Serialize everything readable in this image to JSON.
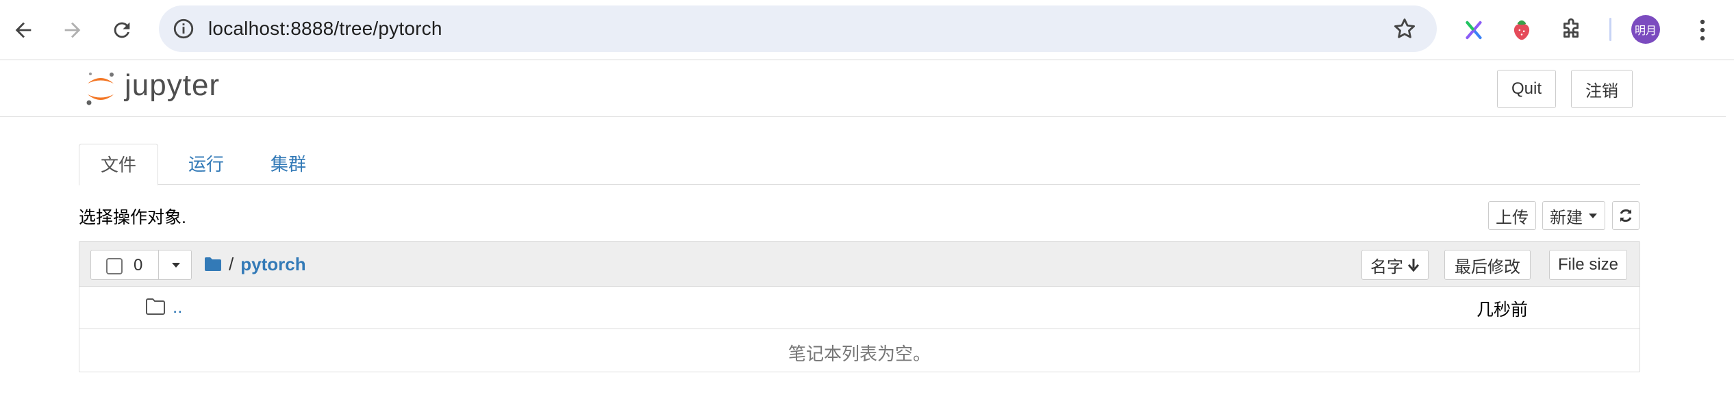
{
  "browser": {
    "url": "localhost:8888/tree/pytorch",
    "profile_initials": "明月",
    "icons": [
      "back-icon",
      "forward-icon",
      "reload-icon",
      "site-info-icon",
      "bookmark-star-icon",
      "x-extension-icon",
      "strawberry-extension-icon",
      "extensions-puzzle-icon",
      "more-menu-icon"
    ]
  },
  "header": {
    "logo_text": "jupyter",
    "quit_label": "Quit",
    "logout_label": "注销"
  },
  "tabs": [
    {
      "label": "文件",
      "active": true
    },
    {
      "label": "运行",
      "active": false
    },
    {
      "label": "集群",
      "active": false
    }
  ],
  "toolbar": {
    "hint": "选择操作对象.",
    "upload_label": "上传",
    "new_label": "新建",
    "refresh_icon": "refresh-icon"
  },
  "list": {
    "selected_count": "0",
    "breadcrumb_separator": "/",
    "breadcrumb_folder": "pytorch",
    "sort_name_label": "名字",
    "sort_modified_label": "最后修改",
    "sort_size_label": "File size",
    "parent_link": "..",
    "parent_modified": "几秒前",
    "empty_message": "笔记本列表为空。"
  },
  "colors": {
    "link": "#337ab7",
    "logo_orange": "#f37726",
    "omnibox_bg": "#eaeef7",
    "avatar_bg": "#7b4bbf"
  }
}
